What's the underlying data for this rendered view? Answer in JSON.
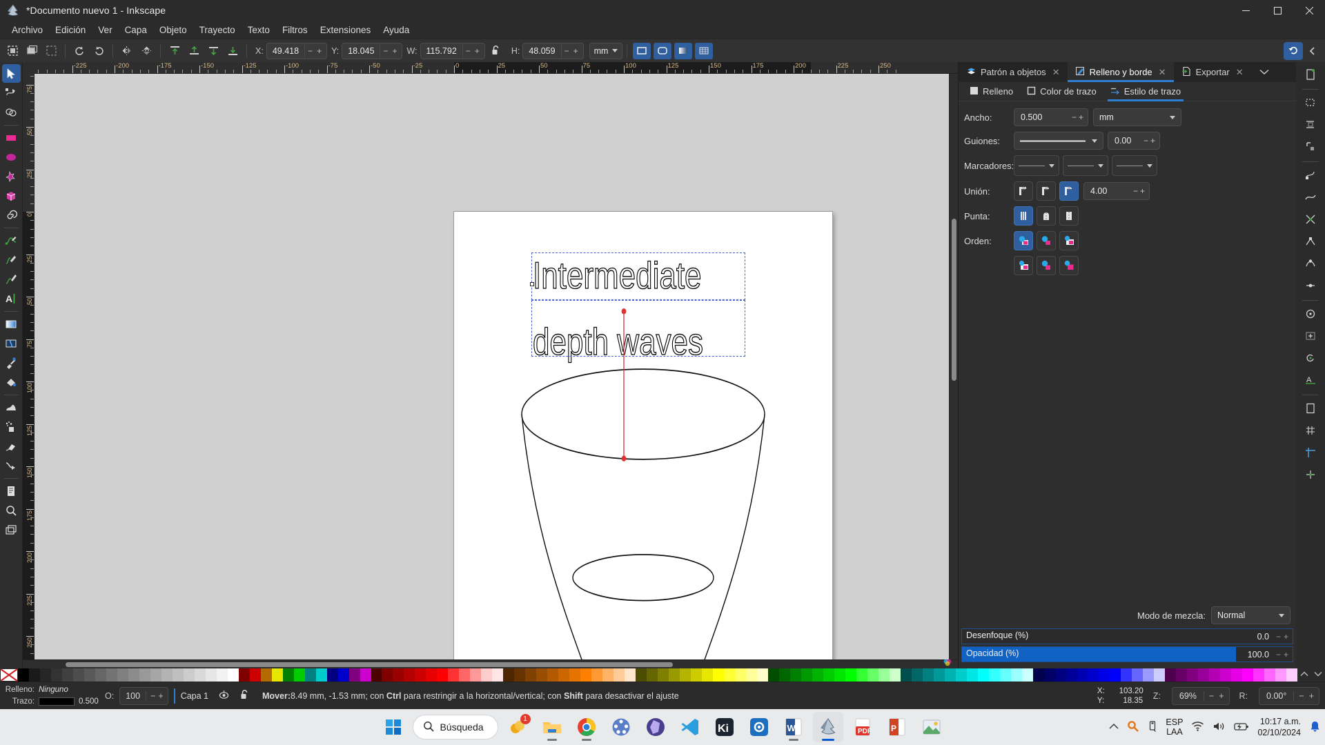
{
  "window": {
    "title": "*Documento nuevo 1 - Inkscape",
    "app_icon": "inkscape-logo-icon",
    "controls": {
      "minimize": "—",
      "maximize": "☐",
      "close": "✕"
    }
  },
  "menu": {
    "items": [
      "Archivo",
      "Edición",
      "Ver",
      "Capa",
      "Objeto",
      "Trayecto",
      "Texto",
      "Filtros",
      "Extensiones",
      "Ayuda"
    ]
  },
  "tool_options": {
    "x": {
      "label": "X:",
      "value": "49.418"
    },
    "y": {
      "label": "Y:",
      "value": "18.045"
    },
    "w": {
      "label": "W:",
      "value": "115.792"
    },
    "h": {
      "label": "H:",
      "value": "48.059"
    },
    "unit": "mm",
    "lock_icon": "lock-open-icon",
    "minus": "−",
    "plus": "+"
  },
  "toolbox": {
    "tools": [
      {
        "name": "selector-tool",
        "label": "Selector",
        "active": true
      },
      {
        "name": "node-tool",
        "label": "Nodo",
        "active": false
      },
      {
        "name": "boolean-tool",
        "label": "Operaciones booleanas",
        "active": false
      },
      {
        "name": "rectangle-tool",
        "label": "Rectángulo",
        "active": false
      },
      {
        "name": "ellipse-tool",
        "label": "Elipse",
        "active": false
      },
      {
        "name": "star-tool",
        "label": "Estrella",
        "active": false
      },
      {
        "name": "box3d-tool",
        "label": "Caja 3D",
        "active": false
      },
      {
        "name": "spiral-tool",
        "label": "Espiral",
        "active": false
      },
      {
        "name": "pencil-tool",
        "label": "Lápiz",
        "active": false
      },
      {
        "name": "bezier-tool",
        "label": "Bezier",
        "active": false
      },
      {
        "name": "calligraphy-tool",
        "label": "Caligrafía",
        "active": false
      },
      {
        "name": "text-tool",
        "label": "Texto",
        "active": false
      },
      {
        "name": "gradient-tool",
        "label": "Degradado",
        "active": false
      },
      {
        "name": "mesh-tool",
        "label": "Malla",
        "active": false
      },
      {
        "name": "dropper-tool",
        "label": "Cuentagotas",
        "active": false
      },
      {
        "name": "paintbucket-tool",
        "label": "Relleno",
        "active": false
      },
      {
        "name": "tweak-tool",
        "label": "Retoque",
        "active": false
      },
      {
        "name": "spray-tool",
        "label": "Spray",
        "active": false
      },
      {
        "name": "eraser-tool",
        "label": "Borrador",
        "active": false
      },
      {
        "name": "connector-tool",
        "label": "Conector",
        "active": false
      },
      {
        "name": "pages-tool",
        "label": "Páginas",
        "active": false
      },
      {
        "name": "zoom-tool",
        "label": "Zoom",
        "active": false
      },
      {
        "name": "measure-tool",
        "label": "Medir",
        "active": false
      }
    ]
  },
  "rulers": {
    "h_labels": [
      "-225",
      "-200",
      "-175",
      "-150",
      "-125",
      "-100",
      "-75",
      "-50",
      "-25",
      "0",
      "25",
      "50",
      "75",
      "100",
      "125",
      "150",
      "175",
      "200",
      "225"
    ],
    "v_labels": [
      "75",
      "50",
      "25",
      "0",
      "25",
      "50",
      "75",
      "100",
      "125",
      "150",
      "175",
      "200"
    ]
  },
  "canvas": {
    "text_line1": "Intermediate",
    "text_line2": "depth waves",
    "guide_color": "#e03030",
    "selection_color": "#4a5fd0"
  },
  "dock": {
    "tabs": [
      {
        "label": "Patrón a objetos",
        "icon": "pattern-to-objects-icon",
        "active": false,
        "close": "✕"
      },
      {
        "label": "Relleno y borde",
        "icon": "fill-stroke-icon",
        "active": true,
        "close": "✕"
      },
      {
        "label": "Exportar",
        "icon": "export-icon",
        "active": false,
        "close": "✕"
      }
    ],
    "overflow_icon": "chevron-down-icon",
    "subtabs": [
      {
        "label": "Relleno",
        "icon": "fill-swatch-icon",
        "active": false
      },
      {
        "label": "Color de trazo",
        "icon": "stroke-swatch-icon",
        "active": false
      },
      {
        "label": "Estilo de trazo",
        "icon": "stroke-style-icon",
        "active": true
      }
    ],
    "stroke_style": {
      "width_label": "Ancho:",
      "width_value": "0.500",
      "width_unit": "mm",
      "dashes_label": "Guiones:",
      "dash_offset": "0.00",
      "markers_label": "Marcadores:",
      "join_label": "Unión:",
      "miter_value": "4.00",
      "cap_label": "Punta:",
      "order_label": "Orden:",
      "join_selected_index": 2,
      "cap_selected_index": 0,
      "order_selected_index": 0
    },
    "blend": {
      "label": "Modo de mezcla:",
      "value": "Normal"
    },
    "blur": {
      "label": "Desenfoque (%)",
      "value": "0.0",
      "percent": 0
    },
    "opacity": {
      "label": "Opacidad (%)",
      "value": "100.0",
      "percent": 100
    }
  },
  "snapbar": {
    "buttons": [
      "snap-enable-icon",
      "snap-bbox-icon",
      "snap-bbox-edge-icon",
      "snap-bbox-corner-icon",
      "snap-node-icon",
      "snap-path-icon",
      "snap-path-intersection-icon",
      "snap-cusp-node-icon",
      "snap-smooth-node-icon",
      "snap-midpoint-icon",
      "snap-others-icon",
      "snap-center-icon",
      "snap-rotation-center-icon",
      "snap-text-baseline-icon",
      "snap-page-border-icon",
      "snap-grid-icon",
      "snap-guide-icon",
      "snap-grid-guide-intersection-icon"
    ]
  },
  "status": {
    "fill_label": "Relleno:",
    "fill_value": "Ninguno",
    "stroke_label": "Trazo:",
    "stroke_width": "0.500",
    "opacity_label": "O:",
    "opacity_value": "100",
    "layer_name": "Capa 1",
    "layer_visible_icon": "eye-icon",
    "layer_lock_icon": "lock-open-icon",
    "message_prefix": "Mover:",
    "message_coords": "8.49 mm, -1.53 mm; con ",
    "message_key1": "Ctrl",
    "message_mid": " para restringir a la horizontal/vertical; con ",
    "message_key2": "Shift",
    "message_end": " para desactivar el ajuste",
    "cursor_x_label": "X:",
    "cursor_x": "103.20",
    "cursor_y_label": "Y:",
    "cursor_y": "18.35",
    "zoom_label": "Z:",
    "zoom_value": "69%",
    "rotate_label": "R:",
    "rotate_value": "0.00°"
  },
  "taskbar": {
    "start_icon": "windows-start-icon",
    "search_placeholder": "Búsqueda",
    "search_icon": "search-icon",
    "apps": [
      {
        "name": "copilot-taskbar-icon",
        "badge": "1",
        "running": false
      },
      {
        "name": "file-explorer-taskbar-icon",
        "badge": "",
        "running": true
      },
      {
        "name": "chrome-taskbar-icon",
        "badge": "",
        "running": true
      },
      {
        "name": "geogebra-taskbar-icon",
        "badge": "",
        "running": false
      },
      {
        "name": "obsidian-taskbar-icon",
        "badge": "",
        "running": false
      },
      {
        "name": "vscode-taskbar-icon",
        "badge": "",
        "running": false
      },
      {
        "name": "kimi-taskbar-icon",
        "badge": "",
        "running": false
      },
      {
        "name": "settings-taskbar-icon",
        "badge": "",
        "running": false
      },
      {
        "name": "word-taskbar-icon",
        "badge": "",
        "running": true
      },
      {
        "name": "inkscape-taskbar-icon",
        "badge": "",
        "running": true,
        "active": true
      },
      {
        "name": "acrobat-taskbar-icon",
        "badge": "",
        "running": false
      },
      {
        "name": "powerpoint-taskbar-icon",
        "badge": "",
        "running": false
      },
      {
        "name": "photos-taskbar-icon",
        "badge": "",
        "running": false
      }
    ],
    "tray": {
      "overflow_icon": "chevron-up-icon",
      "search-highlight-icon": "magnifier-orange-icon",
      "usb_icon": "usb-eject-icon",
      "lang_line1": "ESP",
      "lang_line2": "LAA",
      "wifi_icon": "wifi-icon",
      "volume_icon": "speaker-icon",
      "battery_icon": "battery-charging-icon",
      "time": "10:17 a.m.",
      "date": "02/10/2024",
      "notification_icon": "bell-icon"
    }
  },
  "colors": {
    "accent": "#2f7fd4",
    "panel_bg": "#2e2e2e",
    "canvas_bg": "#d0d0d0",
    "taskbar_bg": "#e9eaec"
  },
  "palette": {
    "swatches": [
      "#000000",
      "#1a1a1a",
      "#262626",
      "#333333",
      "#404040",
      "#4d4d4d",
      "#595959",
      "#666666",
      "#737373",
      "#808080",
      "#8c8c8c",
      "#999999",
      "#a6a6a6",
      "#b3b3b3",
      "#bfbfbf",
      "#cccccc",
      "#d9d9d9",
      "#e6e6e6",
      "#f2f2f2",
      "#ffffff",
      "#800000",
      "#cc0000",
      "#b36b00",
      "#e6e600",
      "#008000",
      "#00cc00",
      "#008080",
      "#00cccc",
      "#000080",
      "#0000cc",
      "#800080",
      "#cc00cc",
      "#4d0000",
      "#800000",
      "#990000",
      "#b30000",
      "#cc0000",
      "#e60000",
      "#ff0000",
      "#ff3333",
      "#ff6666",
      "#ff9999",
      "#ffcccc",
      "#ffe6e6",
      "#4d2600",
      "#663300",
      "#804000",
      "#994d00",
      "#b35900",
      "#cc6600",
      "#e67300",
      "#ff8000",
      "#ff9933",
      "#ffb366",
      "#ffcc99",
      "#ffe6cc",
      "#4d4d00",
      "#666600",
      "#808000",
      "#999900",
      "#b3b300",
      "#cccc00",
      "#e6e600",
      "#ffff00",
      "#ffff33",
      "#ffff66",
      "#ffff99",
      "#ffffcc",
      "#004d00",
      "#006600",
      "#008000",
      "#009900",
      "#00b300",
      "#00cc00",
      "#00e600",
      "#00ff00",
      "#33ff33",
      "#66ff66",
      "#99ff99",
      "#ccffcc",
      "#004d4d",
      "#006666",
      "#008080",
      "#009999",
      "#00b3b3",
      "#00cccc",
      "#00e6e6",
      "#00ffff",
      "#33ffff",
      "#66ffff",
      "#99ffff",
      "#ccffff",
      "#00004d",
      "#000066",
      "#000080",
      "#000099",
      "#0000b3",
      "#0000cc",
      "#0000e6",
      "#0000ff",
      "#3333ff",
      "#6666ff",
      "#9999ff",
      "#ccccff",
      "#4d004d",
      "#660066",
      "#800080",
      "#990099",
      "#b300b3",
      "#cc00cc",
      "#e600e6",
      "#ff00ff",
      "#ff33ff",
      "#ff66ff",
      "#ff99ff",
      "#ffccff"
    ]
  }
}
